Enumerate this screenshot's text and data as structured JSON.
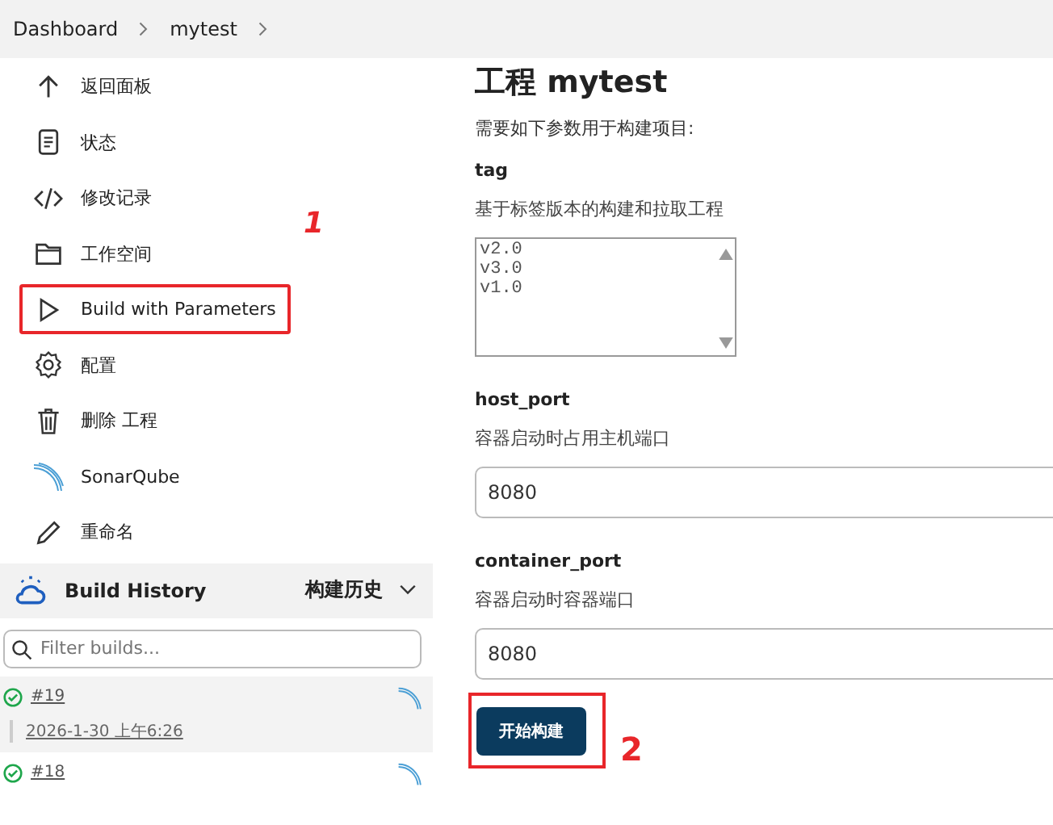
{
  "breadcrumb": [
    "Dashboard",
    "mytest"
  ],
  "nav_items": [
    {
      "label": "返回面板",
      "kind": "up",
      "highlighted": false
    },
    {
      "label": "状态",
      "kind": "doc",
      "highlighted": false
    },
    {
      "label": "修改记录",
      "kind": "code",
      "highlighted": false
    },
    {
      "label": "工作空间",
      "kind": "folder",
      "highlighted": false
    },
    {
      "label": "Build with Parameters",
      "kind": "play",
      "highlighted": true
    },
    {
      "label": "配置",
      "kind": "gear",
      "highlighted": false
    },
    {
      "label": "删除 工程",
      "kind": "trash",
      "highlighted": false
    },
    {
      "label": "SonarQube",
      "kind": "sonar",
      "highlighted": false
    },
    {
      "label": "重命名",
      "kind": "pencil",
      "highlighted": false
    }
  ],
  "build_history": {
    "title": "Build History",
    "menu": "构建历史",
    "filter": {
      "placeholder": "Filter builds..."
    },
    "builds": [
      {
        "number": "#19",
        "time": "2026-1-30 上午6:26",
        "selected": true
      },
      {
        "number": "#18",
        "selected": false
      }
    ]
  },
  "title": "工程 mytest",
  "intro": "需要如下参数用于构建项目:",
  "parameters": [
    {
      "kind": "select",
      "name": "tag",
      "description": "基于标签版本的构建和拉取工程",
      "options": [
        "v2.0",
        "v3.0",
        "v1.0"
      ]
    },
    {
      "kind": "text",
      "name": "host_port",
      "description": "容器启动时占用主机端口",
      "value": "8080"
    },
    {
      "kind": "text",
      "name": "container_port",
      "description": "容器启动时容器端口",
      "value": "8080"
    }
  ],
  "submit": {
    "label": "开始构建",
    "highlighted": true
  },
  "annotation_labels": [
    "1",
    "2"
  ]
}
